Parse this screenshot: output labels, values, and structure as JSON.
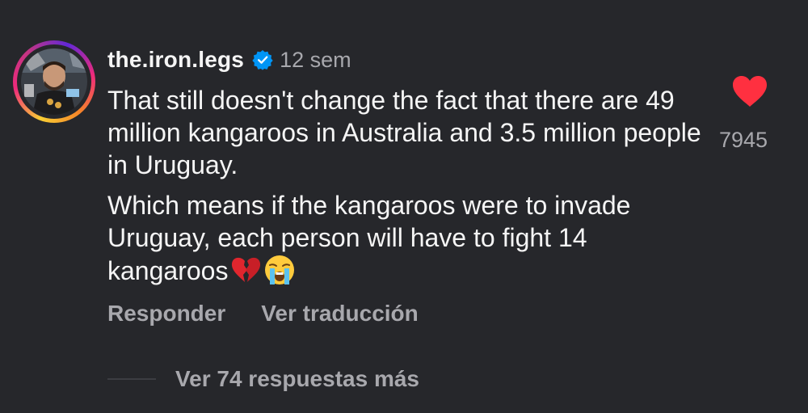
{
  "comment": {
    "username": "the.iron.legs",
    "verified": true,
    "timestamp": "12 sem",
    "paragraphs": [
      "That still doesn't change the fact that there are 49 million kangaroos in Australia and 3.5 million people in Uruguay.",
      "Which means if the kangaroos were to invade Uruguay, each person will have to fight 14 kangaroos"
    ],
    "emojis": [
      "broken-heart-emoji",
      "loudly-crying-face-emoji"
    ],
    "like_count": "7945",
    "liked": true,
    "actions": {
      "reply": "Responder",
      "translate": "Ver traducción"
    },
    "view_replies": "Ver 74 respuestas más"
  },
  "colors": {
    "background": "#26272b",
    "text_primary": "#f5f5f5",
    "text_secondary": "#a8a8ad",
    "like_red": "#ff3040",
    "verified_blue": "#0095f6"
  },
  "icons": {
    "verified": "verified-badge-icon",
    "like": "heart-icon"
  }
}
